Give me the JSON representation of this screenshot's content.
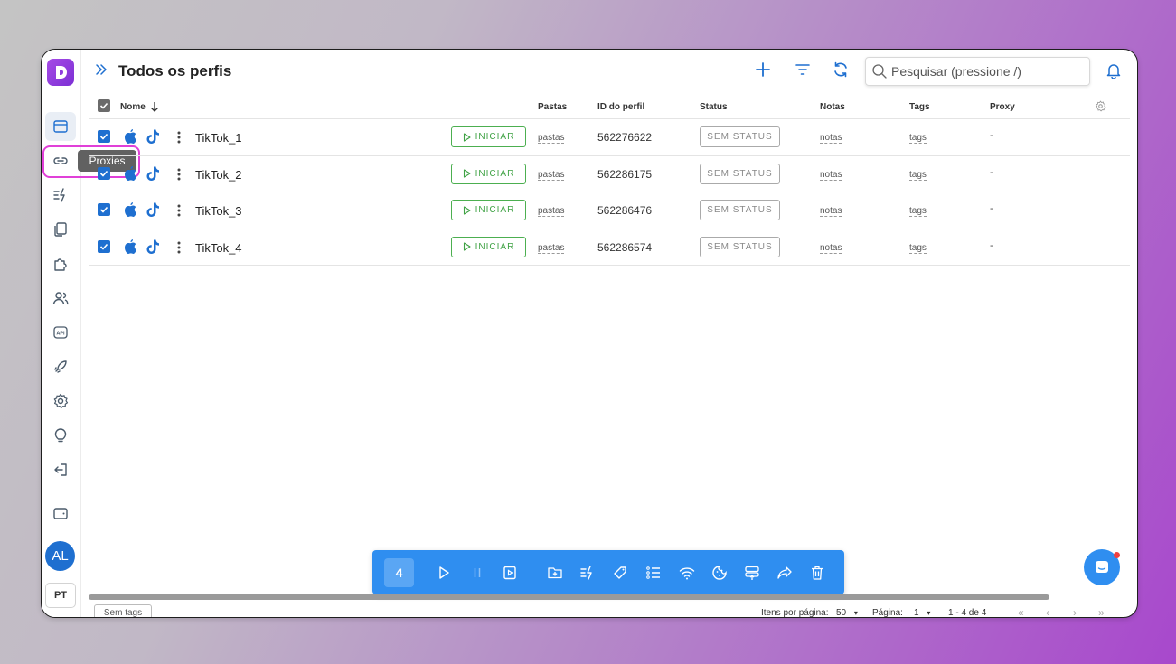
{
  "header": {
    "title": "Todos os perfis",
    "search_placeholder": "Pesquisar (pressione /)"
  },
  "sidebar": {
    "tooltip": "Proxies",
    "avatar_initials": "AL",
    "language": "PT"
  },
  "table": {
    "columns": {
      "name": "Nome",
      "folders": "Pastas",
      "profile_id": "ID do perfil",
      "status": "Status",
      "notes": "Notas",
      "tags": "Tags",
      "proxy": "Proxy"
    },
    "rows": [
      {
        "name": "TikTok_1",
        "action": "INICIAR",
        "folders": "pastas",
        "profile_id": "562276622",
        "status": "SEM STATUS",
        "notes": "notas",
        "tags": "tags",
        "proxy": "-"
      },
      {
        "name": "TikTok_2",
        "action": "INICIAR",
        "folders": "pastas",
        "profile_id": "562286175",
        "status": "SEM STATUS",
        "notes": "notas",
        "tags": "tags",
        "proxy": "-"
      },
      {
        "name": "TikTok_3",
        "action": "INICIAR",
        "folders": "pastas",
        "profile_id": "562286476",
        "status": "SEM STATUS",
        "notes": "notas",
        "tags": "tags",
        "proxy": "-"
      },
      {
        "name": "TikTok_4",
        "action": "INICIAR",
        "folders": "pastas",
        "profile_id": "562286574",
        "status": "SEM STATUS",
        "notes": "notas",
        "tags": "tags",
        "proxy": "-"
      }
    ]
  },
  "toolbar": {
    "selected_count": "4"
  },
  "footer": {
    "tags_chip": "Sem tags",
    "items_per_page_label": "Itens por página:",
    "items_per_page_value": "50",
    "page_label": "Página:",
    "page_value": "1",
    "range": "1 - 4 de 4"
  },
  "colors": {
    "accent": "#1e6fd0",
    "toolbar": "#2f8ef0",
    "start_green": "#4caf50",
    "highlight": "#e040d8"
  }
}
